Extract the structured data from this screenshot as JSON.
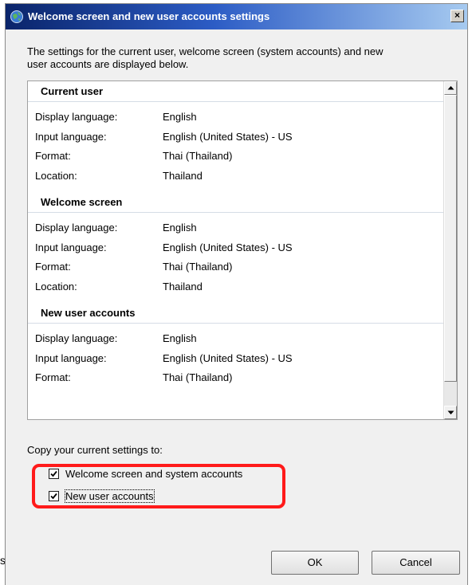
{
  "window": {
    "title": "Welcome screen and new user accounts settings",
    "close_label": "×"
  },
  "description": {
    "line1": "The settings for the current user, welcome screen (system accounts) and new",
    "line2": "user accounts are displayed below."
  },
  "sections": [
    {
      "title": "Current user",
      "rows": [
        {
          "label": "Display language:",
          "value": "English"
        },
        {
          "label": "Input language:",
          "value": "English (United States) - US"
        },
        {
          "label": "Format:",
          "value": "Thai (Thailand)"
        },
        {
          "label": "Location:",
          "value": "Thailand"
        }
      ]
    },
    {
      "title": "Welcome screen",
      "rows": [
        {
          "label": "Display language:",
          "value": "English"
        },
        {
          "label": "Input language:",
          "value": "English (United States) - US"
        },
        {
          "label": "Format:",
          "value": "Thai (Thailand)"
        },
        {
          "label": "Location:",
          "value": "Thailand"
        }
      ]
    },
    {
      "title": "New user accounts",
      "rows": [
        {
          "label": "Display language:",
          "value": "English"
        },
        {
          "label": "Input language:",
          "value": "English (United States) - US"
        },
        {
          "label": "Format:",
          "value": "Thai (Thailand)"
        }
      ]
    }
  ],
  "copy": {
    "label": "Copy your current settings to:",
    "options": [
      {
        "label": "Welcome screen and system accounts",
        "checked": true
      },
      {
        "label": "New user accounts",
        "checked": true
      }
    ]
  },
  "buttons": {
    "ok": "OK",
    "cancel": "Cancel"
  },
  "edge_glyph": "s",
  "colors": {
    "highlight": "#ff1a1a",
    "titlebar_start": "#0a246a",
    "titlebar_end": "#a6caf0"
  }
}
